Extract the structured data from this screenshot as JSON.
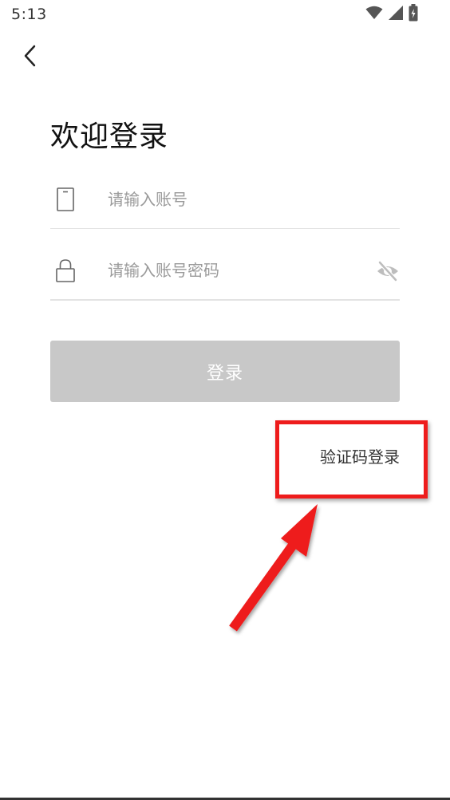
{
  "status_bar": {
    "time": "5:13",
    "icons": [
      "wifi-icon",
      "cellular-signal-icon",
      "battery-charging-icon"
    ]
  },
  "header": {
    "back_icon": "chevron-left-icon"
  },
  "main": {
    "title": "欢迎登录",
    "account_field": {
      "icon": "phone-icon",
      "value": "",
      "placeholder": "请输入账号"
    },
    "password_field": {
      "icon": "lock-icon",
      "value": "",
      "placeholder": "请输入账号密码",
      "visibility_icon": "eye-off-icon"
    },
    "login_button_label": "登录",
    "sms_login_label": "验证码登录"
  },
  "colors": {
    "login_button_bg": "#c8c8c8",
    "annotation": "#ee1c1c",
    "divider": "#e3e3e3"
  }
}
